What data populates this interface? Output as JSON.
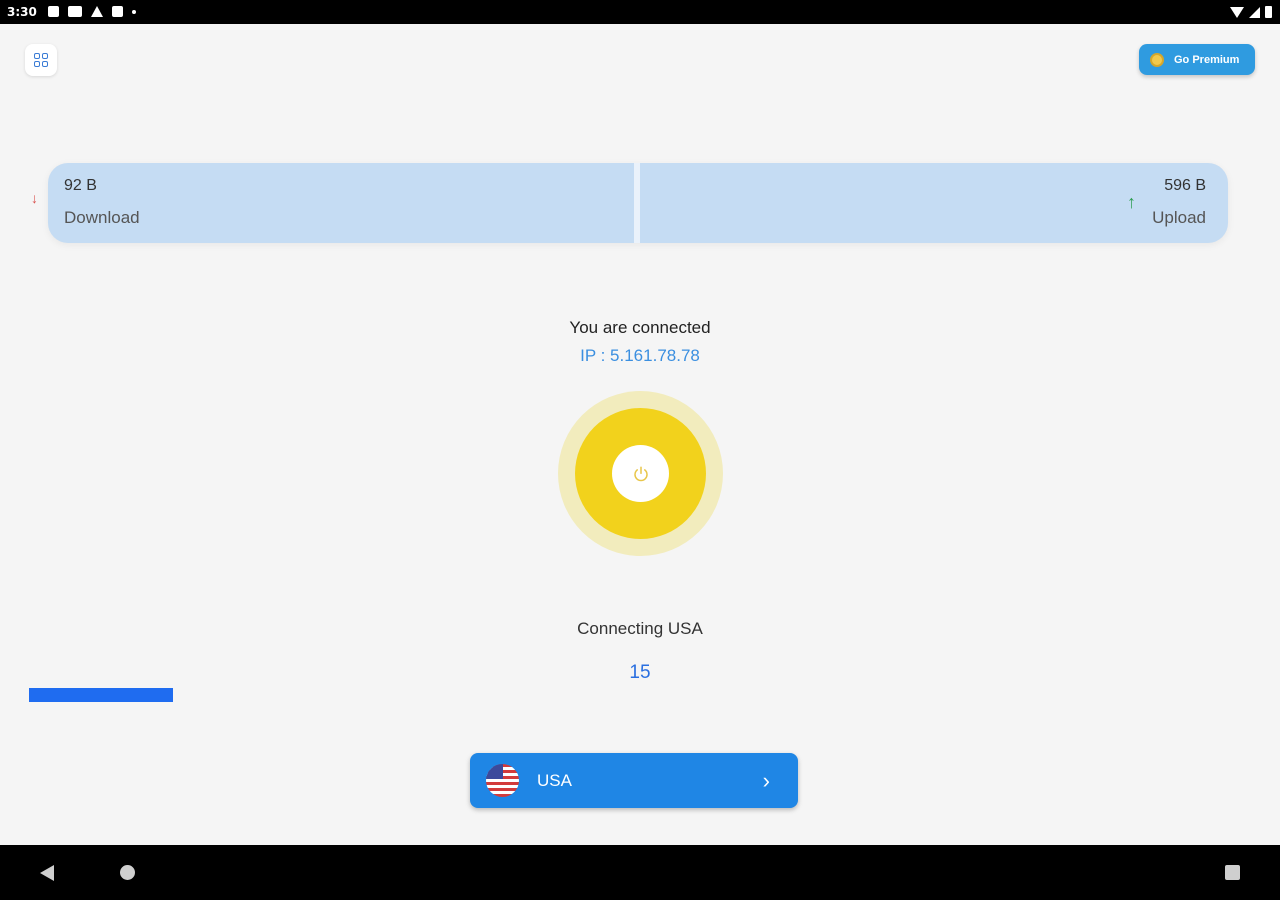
{
  "status_bar": {
    "time": "3:30"
  },
  "header": {
    "premium_label": "Go Premium"
  },
  "traffic": {
    "download_value": "92 B",
    "download_label": "Download",
    "upload_value": "596 B",
    "upload_label": "Upload"
  },
  "connection": {
    "status": "You are connected",
    "ip_text": "IP : 5.161.78.78",
    "connecting_text": "Connecting USA",
    "counter": "15"
  },
  "country": {
    "name": "USA"
  },
  "colors": {
    "accent": "#1f86e5",
    "power_ring": "#f2d21c",
    "card_bg": "#c5dcf3",
    "download_arrow": "#d9534f",
    "upload_arrow": "#2e9e52"
  }
}
